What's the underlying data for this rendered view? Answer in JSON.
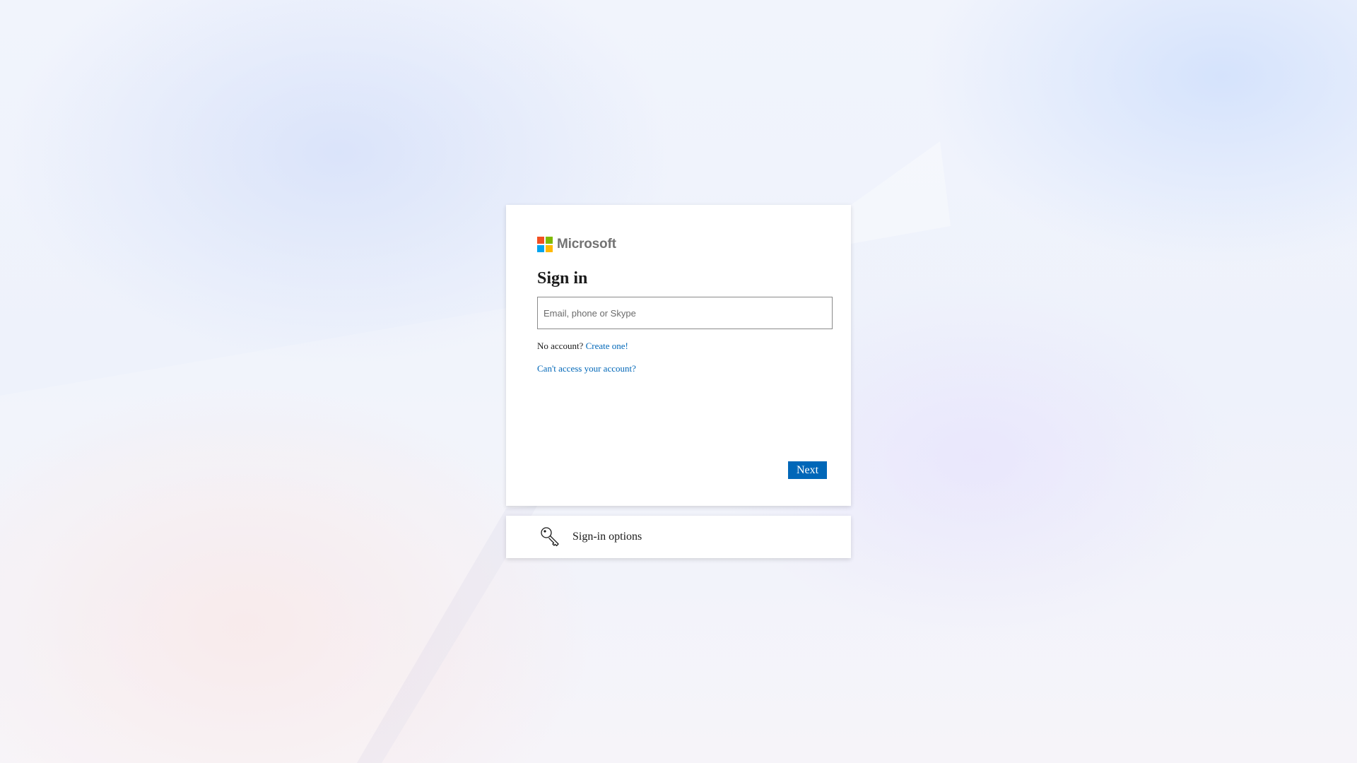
{
  "brand": {
    "name": "Microsoft",
    "colors": [
      "#f25022",
      "#7fba00",
      "#00a4ef",
      "#ffb900"
    ]
  },
  "signin": {
    "title": "Sign in",
    "input_placeholder": "Email, phone or Skype",
    "no_account_text": "No account?",
    "create_link": "Create one!",
    "cant_access_link": "Can't access your account?",
    "next_label": "Next"
  },
  "options": {
    "label": "Sign-in options",
    "icon": "key-icon"
  },
  "theme": {
    "accent": "#0067b8",
    "text": "#1b1b1b"
  }
}
